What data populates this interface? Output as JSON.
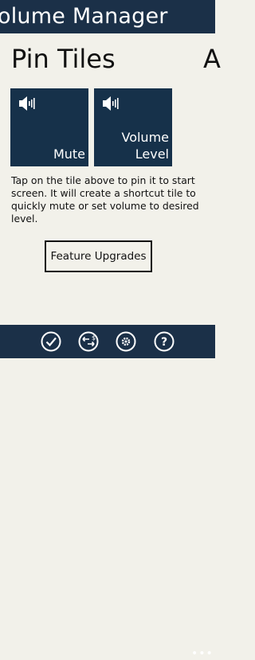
{
  "header": {
    "app_title": "olume Manager"
  },
  "pivot": {
    "title": "Pin Tiles",
    "next_title_peek": "A"
  },
  "tiles": [
    {
      "label": "Mute",
      "icon": "speaker-icon"
    },
    {
      "label": "Volume\nLevel",
      "icon": "speaker-icon"
    }
  ],
  "description": "Tap on the tile above to pin it to start screen. It will create a shortcut tile to quickly mute or set volume to desired level.",
  "feature_button": {
    "label": "Feature Upgrades"
  },
  "appbar": {
    "buttons": [
      "check-icon",
      "currency-exchange-icon",
      "settings-icon",
      "help-icon"
    ],
    "more_label": "•••"
  },
  "colors": {
    "header_bg": "#1b3048",
    "tile_bg": "#16314a",
    "page_bg": "#f2f1ea",
    "appbar_bg": "#1b3048"
  }
}
